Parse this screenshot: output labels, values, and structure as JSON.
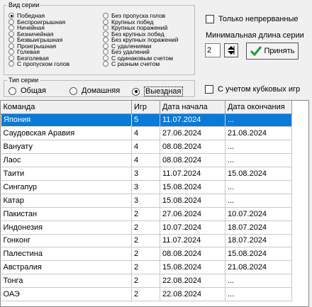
{
  "series_type": {
    "title": "Вид серии",
    "left": [
      {
        "label": "Победная",
        "selected": true
      },
      {
        "label": "Беспроигрышная",
        "selected": false
      },
      {
        "label": "Ничейная",
        "selected": false
      },
      {
        "label": "Безничейная",
        "selected": false
      },
      {
        "label": "Безвыигрышная",
        "selected": false
      },
      {
        "label": "Проигрышная",
        "selected": false
      },
      {
        "label": "Голевая",
        "selected": false
      },
      {
        "label": "Безголевая",
        "selected": false
      },
      {
        "label": "С пропуском голов",
        "selected": false
      }
    ],
    "right": [
      {
        "label": "Без пропуска голов",
        "selected": false
      },
      {
        "label": "Крупных побед",
        "selected": false
      },
      {
        "label": "Крупных поражений",
        "selected": false
      },
      {
        "label": "Без крупных побед",
        "selected": false
      },
      {
        "label": "Без крупных поражений",
        "selected": false
      },
      {
        "label": "С удалениями",
        "selected": false
      },
      {
        "label": "Без удалений",
        "selected": false
      },
      {
        "label": "С одинаковым счетом",
        "selected": false
      },
      {
        "label": "С разным счетом",
        "selected": false
      }
    ]
  },
  "options": {
    "continuous_label": "Только непрерванные",
    "min_length_label": "Минимальная длина серии",
    "min_length_value": "2",
    "apply_label": "Принять",
    "cup_games_label": "С учетом кубковых игр"
  },
  "match_type": {
    "title": "Тип серии",
    "options": [
      {
        "label": "Общая",
        "selected": false
      },
      {
        "label": "Домашняя",
        "selected": false
      },
      {
        "label": "Выездная",
        "selected": true
      }
    ]
  },
  "table": {
    "columns": [
      "Команда",
      "Игр",
      "Дата начала",
      "Дата окончания"
    ],
    "rows": [
      [
        "Япония",
        "5",
        "11.07.2024",
        "..."
      ],
      [
        "Саудовская Аравия",
        "4",
        "27.06.2024",
        "21.08.2024"
      ],
      [
        "Вануату",
        "4",
        "08.08.2024",
        "..."
      ],
      [
        "Лаос",
        "4",
        "08.08.2024",
        "..."
      ],
      [
        "Таити",
        "3",
        "11.07.2024",
        "15.08.2024"
      ],
      [
        "Сингапур",
        "3",
        "15.08.2024",
        "..."
      ],
      [
        "Катар",
        "3",
        "15.08.2024",
        "..."
      ],
      [
        "Пакистан",
        "2",
        "27.06.2024",
        "10.07.2024"
      ],
      [
        "Индонезия",
        "2",
        "10.07.2024",
        "18.07.2024"
      ],
      [
        "Гонконг",
        "2",
        "11.07.2024",
        "18.07.2024"
      ],
      [
        "Палестина",
        "2",
        "08.08.2024",
        "15.08.2024"
      ],
      [
        "Австралия",
        "2",
        "15.08.2024",
        "21.08.2024"
      ],
      [
        "Тонга",
        "2",
        "22.08.2024",
        "..."
      ],
      [
        "ОАЭ",
        "2",
        "22.08.2024",
        "..."
      ]
    ],
    "selected_row": 0
  },
  "colors": {
    "selection": "#0a7ad8",
    "background": "#f0f0f0",
    "apply_check": "#1e9e3a"
  }
}
